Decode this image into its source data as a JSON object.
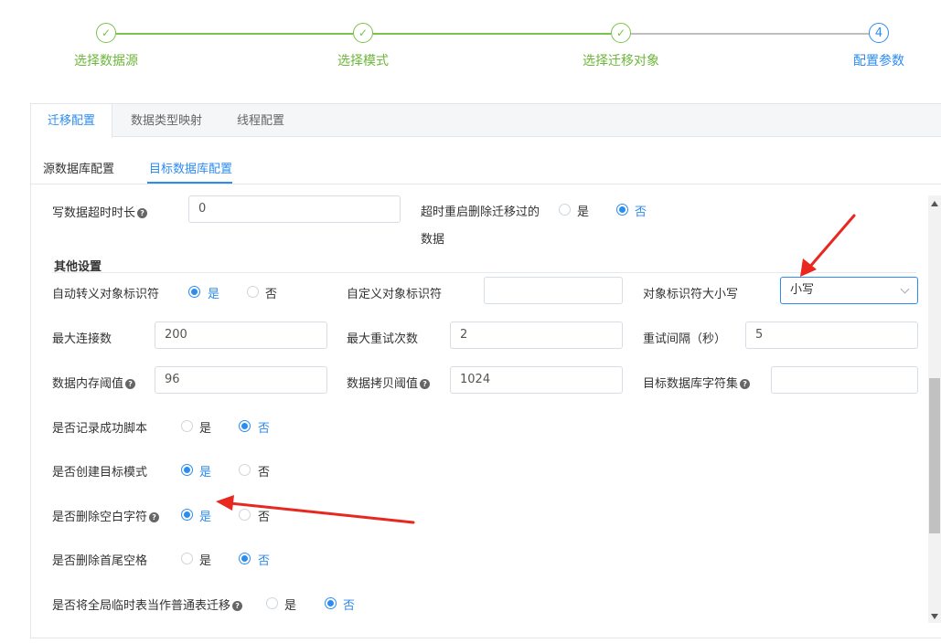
{
  "steps": [
    {
      "label": "选择数据源",
      "icon": "check-icon",
      "status": "done"
    },
    {
      "label": "选择模式",
      "icon": "check-icon",
      "status": "done"
    },
    {
      "label": "选择迁移对象",
      "icon": "check-icon",
      "status": "done"
    },
    {
      "label": "配置参数",
      "number": "4",
      "status": "active"
    }
  ],
  "tabs": [
    "迁移配置",
    "数据类型映射",
    "线程配置"
  ],
  "subtabs": [
    "源数据库配置",
    "目标数据库配置"
  ],
  "fields": {
    "write_timeout": {
      "label": "写数据超时时长",
      "value": "0"
    },
    "timeout_restart_delete": {
      "label_line1": "超时重启删除迁移过的",
      "label_line2": "数据",
      "yes": "是",
      "no": "否",
      "selected": "否"
    },
    "other_settings": "其他设置",
    "auto_escape": {
      "label": "自动转义对象标识符",
      "yes": "是",
      "no": "否",
      "selected": "是"
    },
    "custom_identifier": {
      "label": "自定义对象标识符",
      "value": ""
    },
    "identifier_case": {
      "label": "对象标识符大小写",
      "value": "小写"
    },
    "max_connections": {
      "label": "最大连接数",
      "value": "200"
    },
    "max_retries": {
      "label": "最大重试次数",
      "value": "2"
    },
    "retry_interval": {
      "label": "重试间隔（秒）",
      "value": "5"
    },
    "memory_threshold": {
      "label": "数据内存阈值",
      "value": "96"
    },
    "copy_threshold": {
      "label": "数据拷贝阈值",
      "value": "1024"
    },
    "target_charset": {
      "label": "目标数据库字符集",
      "value": ""
    },
    "log_success_script": {
      "label": "是否记录成功脚本",
      "yes": "是",
      "no": "否",
      "selected": "否"
    },
    "create_target_schema": {
      "label": "是否创建目标模式",
      "yes": "是",
      "no": "否",
      "selected": "是"
    },
    "delete_blank_chars": {
      "label": "是否删除空白字符",
      "yes": "是",
      "no": "否",
      "selected": "是"
    },
    "trim_spaces": {
      "label": "是否删除首尾空格",
      "yes": "是",
      "no": "否",
      "selected": "否"
    },
    "global_temp_as_normal": {
      "label": "是否将全局临时表当作普通表迁移",
      "yes": "是",
      "no": "否",
      "selected": "否"
    }
  },
  "colors": {
    "accent": "#2d8cf0",
    "done": "#7cc248",
    "annotation": "#e8271f"
  }
}
